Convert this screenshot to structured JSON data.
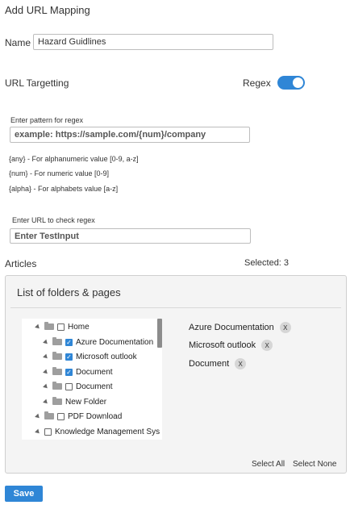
{
  "title": "Add URL Mapping",
  "name": {
    "label": "Name",
    "value": "Hazard Guidlines"
  },
  "targeting": {
    "label": "URL Targetting",
    "regex_label": "Regex",
    "regex_on": true
  },
  "regex": {
    "pattern_label": "Enter pattern for regex",
    "pattern_placeholder": "example: https://sample.com/{num}/company",
    "hints": [
      "{any} - For alphanumeric value [0-9, a-z]",
      "{num} - For numeric value [0-9]",
      "{alpha} - For alphabets value [a-z]"
    ],
    "check_label": "Enter URL to check regex",
    "check_placeholder": "Enter TestInput"
  },
  "articles": {
    "label": "Articles",
    "selected_text": "Selected: 3",
    "panel_title": "List of folders & pages",
    "tree": [
      {
        "label": "Home",
        "checked": false
      },
      {
        "label": "Azure Documentation",
        "checked": true
      },
      {
        "label": "Microsoft outlook",
        "checked": true
      },
      {
        "label": "Document",
        "checked": true
      },
      {
        "label": "Document",
        "checked": false
      },
      {
        "label": "New Folder",
        "checked": null
      },
      {
        "label": "PDF Download",
        "checked": false
      },
      {
        "label": "Knowledge Management Sys",
        "checked": false
      }
    ],
    "selected_items": [
      "Azure Documentation",
      "Microsoft outlook",
      "Document"
    ],
    "remove_glyph": "X",
    "select_all": "Select All",
    "select_none": "Select None"
  },
  "save_label": "Save",
  "colors": {
    "accent": "#2f86d6"
  }
}
